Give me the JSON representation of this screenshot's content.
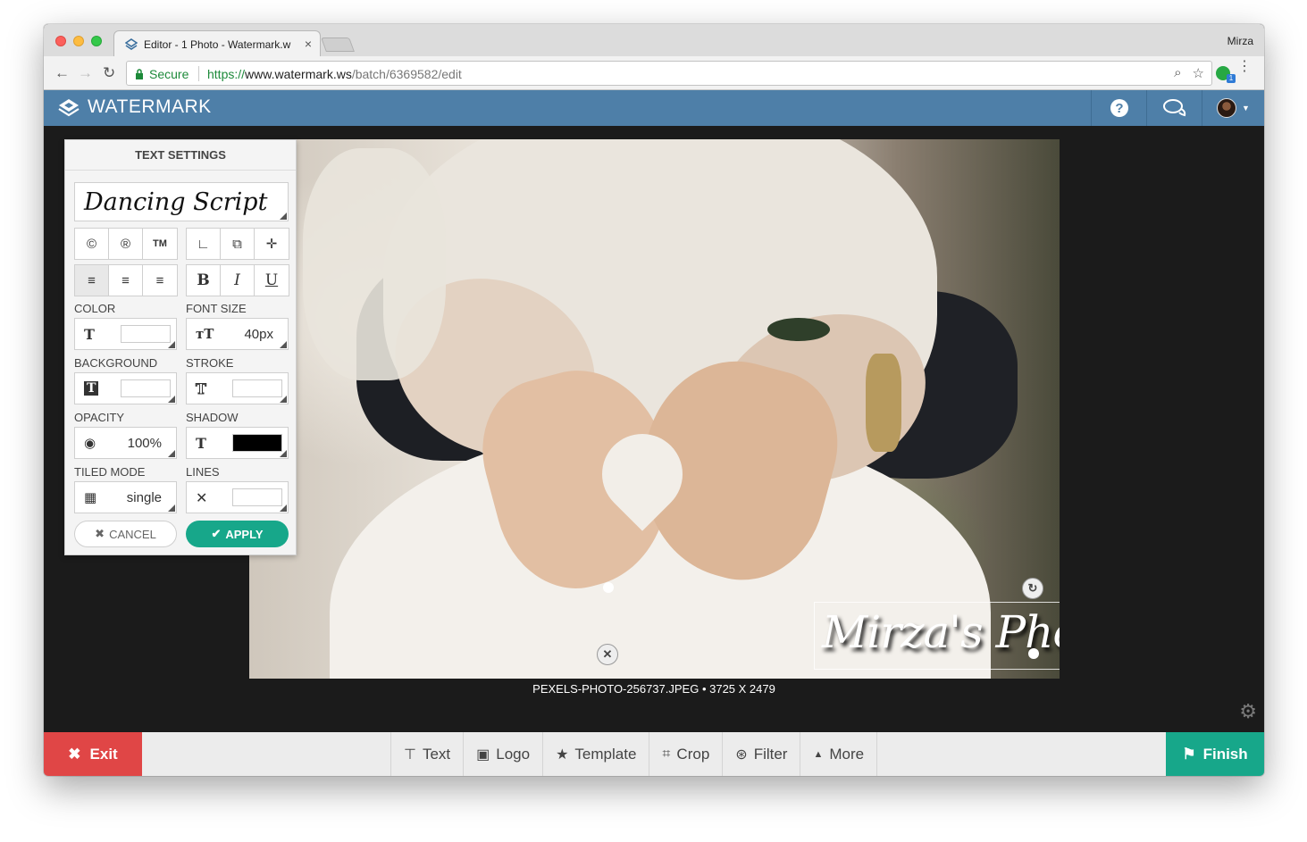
{
  "browser": {
    "tab_title": "Editor - 1 Photo - Watermark.w",
    "profile_name": "Mirza",
    "secure_label": "Secure",
    "url_scheme": "https://",
    "url_host": "www.watermark.ws",
    "url_path": "/batch/6369582/edit",
    "extension_badge": "1"
  },
  "app": {
    "brand": "WATERMARK",
    "header_icons": [
      "help-icon",
      "chat-icon",
      "avatar"
    ]
  },
  "panel": {
    "title": "TEXT SETTINGS",
    "font": "Dancing Script",
    "symbols": [
      "©",
      "®",
      "TM"
    ],
    "color_label": "COLOR",
    "font_size_label": "FONT SIZE",
    "font_size_value": "40px",
    "background_label": "BACKGROUND",
    "stroke_label": "STROKE",
    "opacity_label": "OPACITY",
    "opacity_value": "100%",
    "shadow_label": "SHADOW",
    "shadow_color": "#000000",
    "tiled_label": "TILED MODE",
    "tiled_value": "single",
    "lines_label": "LINES",
    "cancel_label": "CANCEL",
    "apply_label": "APPLY"
  },
  "canvas": {
    "watermark_text": "Mirza's Photography",
    "caption": "PEXELS-PHOTO-256737.JPEG • 3725 X 2479"
  },
  "bottom": {
    "exit_label": "Exit",
    "finish_label": "Finish",
    "tools": [
      "Text",
      "Logo",
      "Template",
      "Crop",
      "Filter",
      "More"
    ]
  },
  "colors": {
    "appbar": "#4e7fa8",
    "exit": "#e04646",
    "finish": "#17a78a",
    "apply": "#17a78a"
  }
}
